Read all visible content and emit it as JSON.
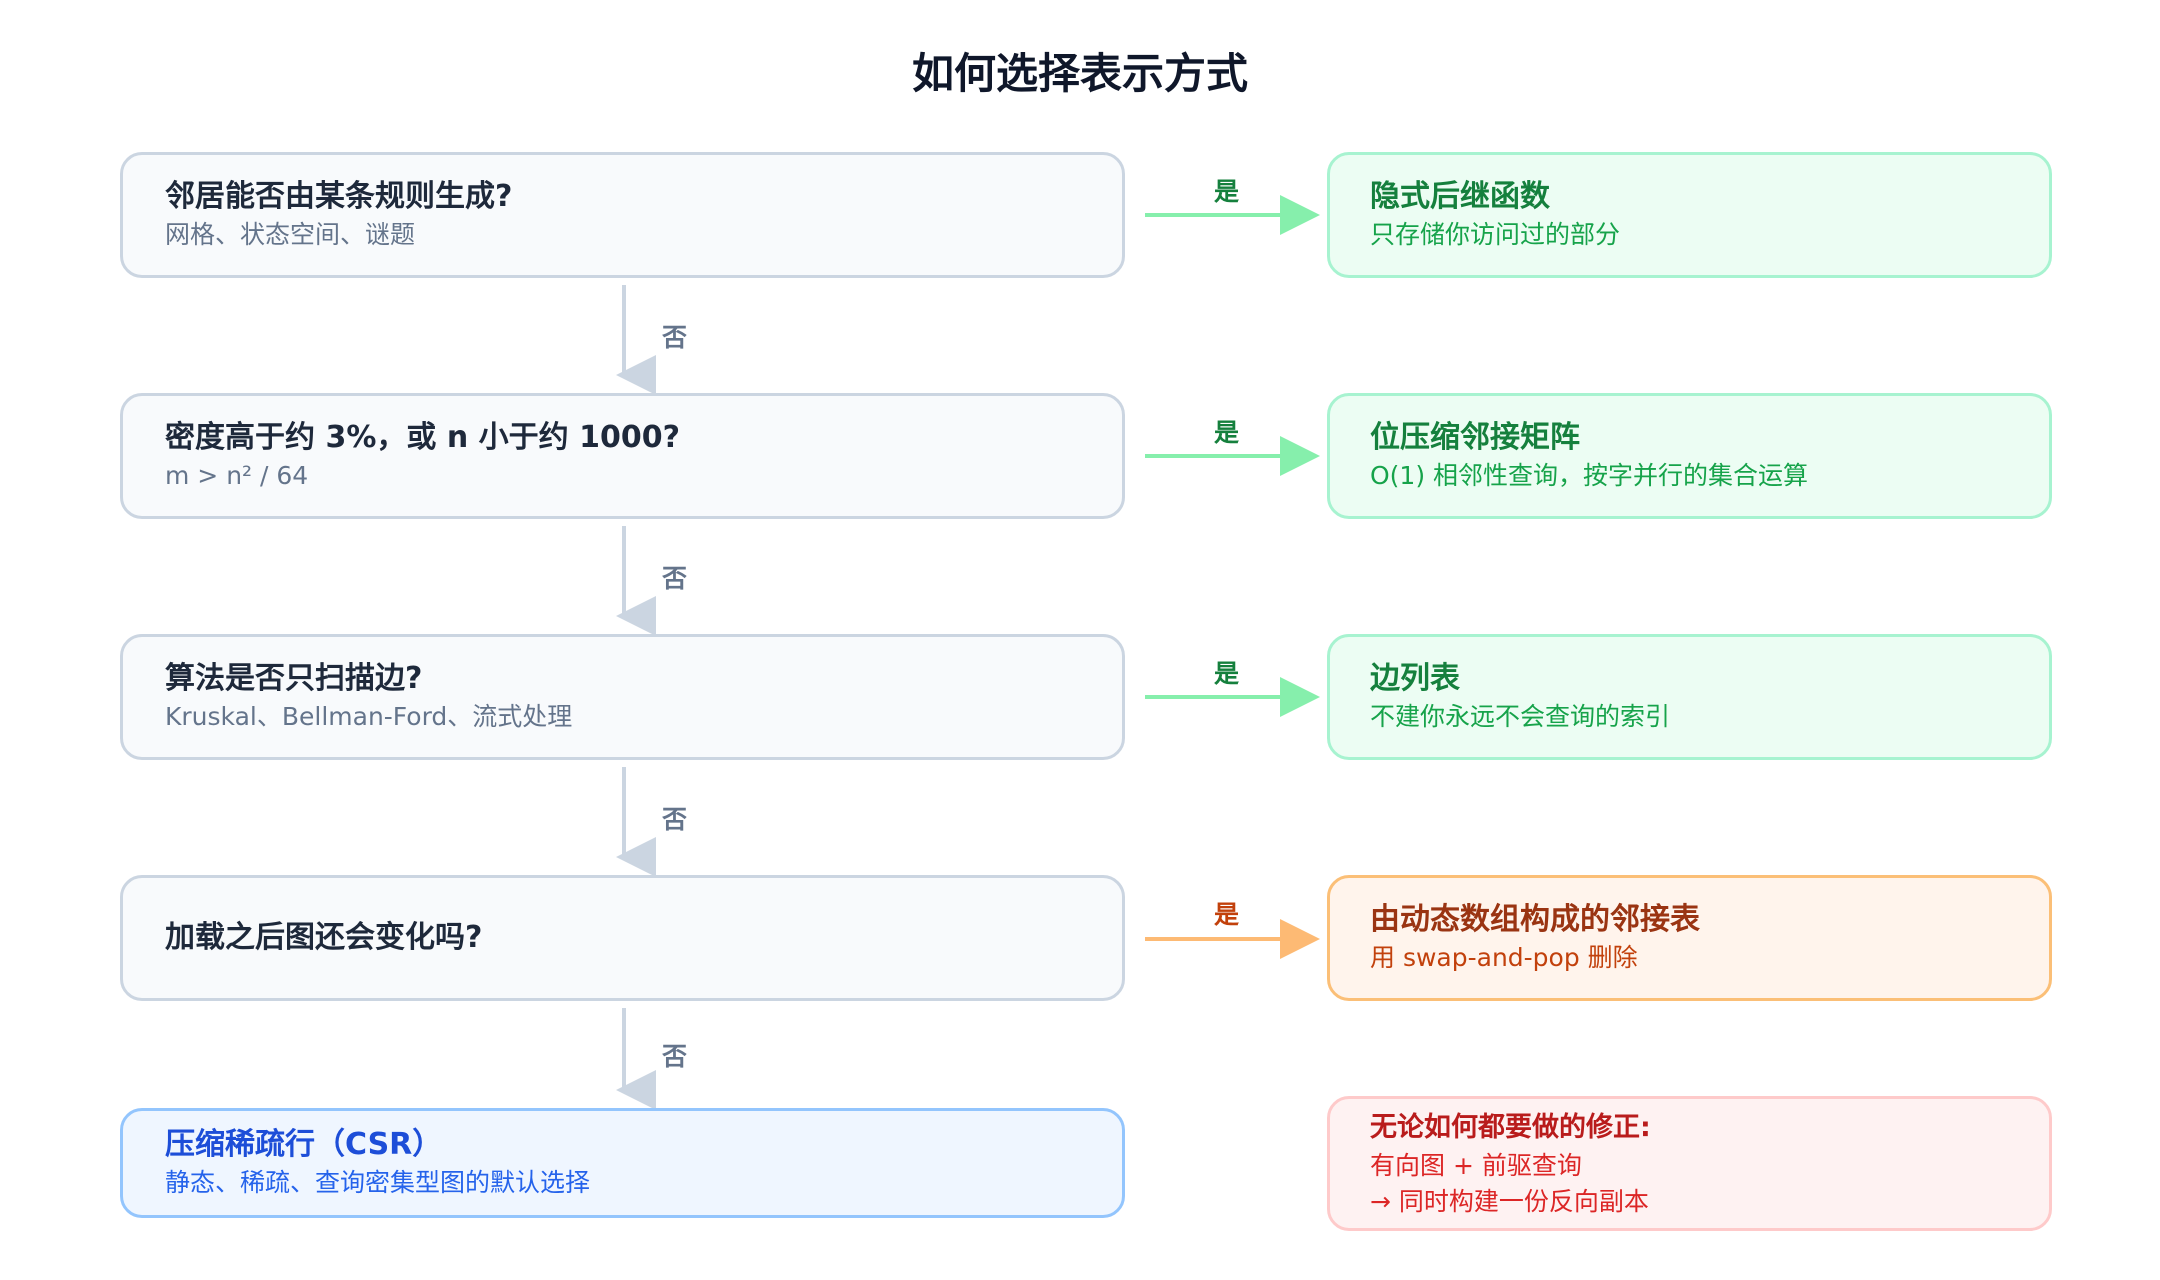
{
  "title": "如何选择表示方式",
  "questions": [
    {
      "title": "邻居能否由某条规则生成?",
      "sub": "网格、状态空间、谜题"
    },
    {
      "title": "密度高于约 3%，或 n 小于约 1000?",
      "sub": "m > n² / 64"
    },
    {
      "title": "算法是否只扫描边?",
      "sub": "Kruskal、Bellman-Ford、流式处理"
    },
    {
      "title": "加载之后图还会变化吗?",
      "sub": ""
    }
  ],
  "answers": [
    {
      "title": "隐式后继函数",
      "sub": "只存储你访问过的部分"
    },
    {
      "title": "位压缩邻接矩阵",
      "sub": "O(1) 相邻性查询，按字并行的集合运算"
    },
    {
      "title": "边列表",
      "sub": "不建你永远不会查询的索引"
    },
    {
      "title": "由动态数组构成的邻接表",
      "sub": "用 swap-and-pop 删除"
    }
  ],
  "default": {
    "title": "压缩稀疏行（CSR）",
    "sub": "静态、稀疏、查询密集型图的默认选择"
  },
  "note": {
    "title": "无论如何都要做的修正:",
    "line1": "有向图 + 前驱查询",
    "line2": "→ 同时构建一份反向副本"
  },
  "labels": {
    "yes": "是",
    "no": "否"
  },
  "colors": {
    "green_arrow": "#86efac",
    "orange_arrow": "#fdba74",
    "gray_arrow": "#cbd5e1"
  }
}
